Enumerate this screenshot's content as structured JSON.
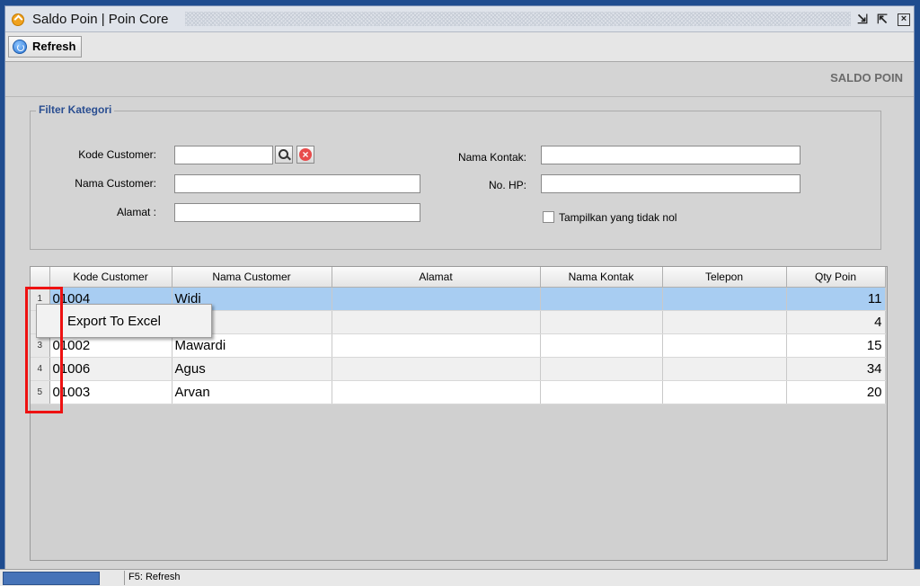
{
  "window": {
    "title": "Saldo Poin | Poin Core"
  },
  "toolbar": {
    "refresh_label": "Refresh"
  },
  "header": {
    "title": "SALDO POIN"
  },
  "filter": {
    "legend": "Filter Kategori",
    "kode_customer_label": "Kode Customer:",
    "nama_customer_label": "Nama Customer:",
    "alamat_label": "Alamat :",
    "nama_kontak_label": "Nama Kontak:",
    "no_hp_label": "No. HP:",
    "nonzero_label": "Tampilkan yang tidak nol",
    "kode_customer_value": "",
    "nama_customer_value": "",
    "alamat_value": "",
    "nama_kontak_value": "",
    "no_hp_value": ""
  },
  "grid": {
    "columns": [
      "Kode Customer",
      "Nama Customer",
      "Alamat",
      "Nama Kontak",
      "Telepon",
      "Qty Poin"
    ],
    "rows": [
      {
        "num": "1",
        "kode": "01004",
        "nama": "Widi",
        "alamat": "",
        "kontak": "",
        "telepon": "",
        "qty": "11"
      },
      {
        "num": "2",
        "kode": "",
        "nama": "",
        "alamat": "",
        "kontak": "",
        "telepon": "",
        "qty": "4"
      },
      {
        "num": "3",
        "kode": "01002",
        "nama": "Mawardi",
        "alamat": "",
        "kontak": "",
        "telepon": "",
        "qty": "15"
      },
      {
        "num": "4",
        "kode": "01006",
        "nama": "Agus",
        "alamat": "",
        "kontak": "",
        "telepon": "",
        "qty": "34"
      },
      {
        "num": "5",
        "kode": "01003",
        "nama": "Arvan",
        "alamat": "",
        "kontak": "",
        "telepon": "",
        "qty": "20"
      }
    ]
  },
  "context_menu": {
    "export_label": "Export To Excel"
  },
  "status": {
    "hint": "F5: Refresh"
  },
  "colors": {
    "highlight": "#ee1111",
    "selected_row": "#a8cdf2",
    "legend": "#2a4e91"
  },
  "icons": [
    "app-icon",
    "restore-icon",
    "maximize-icon",
    "close-icon",
    "refresh-icon",
    "search-icon",
    "clear-icon"
  ]
}
